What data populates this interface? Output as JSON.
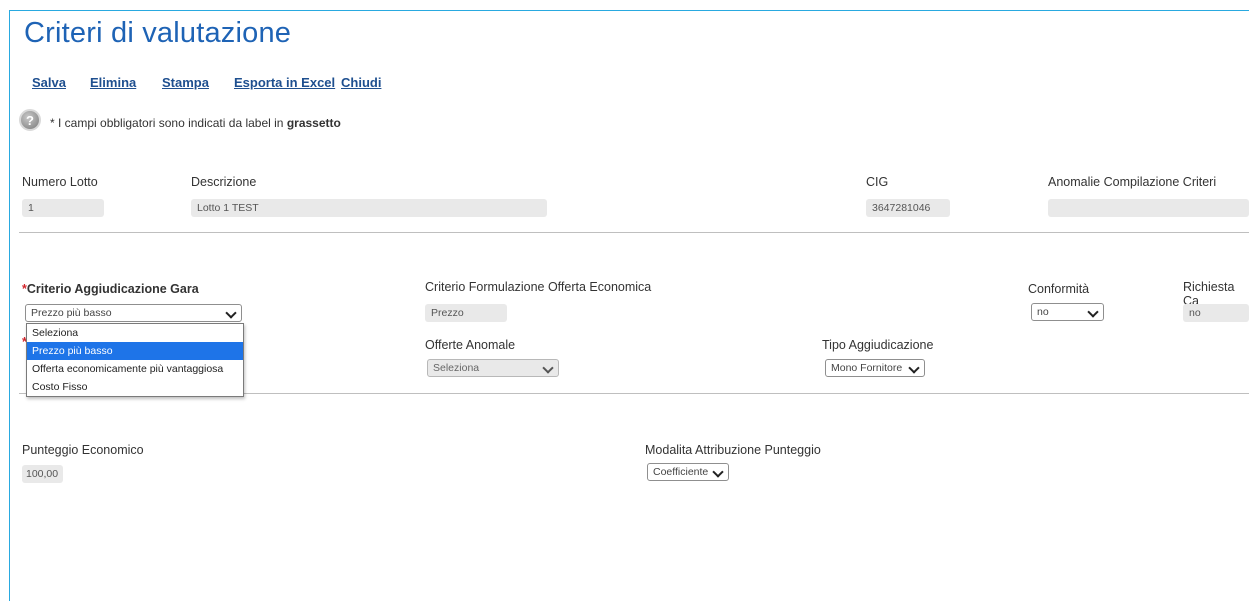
{
  "page": {
    "title": "Criteri di valutazione"
  },
  "toolbar": {
    "salva": "Salva",
    "elimina": "Elimina",
    "stampa": "Stampa",
    "esporta": "Esporta in Excel",
    "chiudi": "Chiudi"
  },
  "note": {
    "icon": "help-icon",
    "prefix": "* I campi obbligatori sono indicati da label in ",
    "bold": "grassetto"
  },
  "lotto": {
    "numero_label": "Numero Lotto",
    "numero_value": "1",
    "descrizione_label": "Descrizione",
    "descrizione_value": "Lotto 1 TEST",
    "cig_label": "CIG",
    "cig_value": "3647281046",
    "anomalie_label": "Anomalie Compilazione Criteri",
    "anomalie_value": ""
  },
  "criteri": {
    "required_mark": "*",
    "aggiudicazione_label": "Criterio Aggiudicazione Gara",
    "aggiudicazione_value": "Prezzo più basso",
    "aggiudicazione_options": [
      "Seleziona",
      "Prezzo più basso",
      "Offerta economicamente più vantaggiosa",
      "Costo Fisso"
    ],
    "aggiudicazione_selected_index": 1,
    "formulazione_label": "Criterio Formulazione Offerta Economica",
    "formulazione_value": "Prezzo",
    "conformita_label": "Conformità",
    "conformita_value": "no",
    "richiesta_label": "Richiesta Ca",
    "richiesta_value": "no",
    "offerte_anomale_label": "Offerte Anomale",
    "offerte_anomale_value": "Seleziona",
    "tipo_aggiudicazione_label": "Tipo Aggiudicazione",
    "tipo_aggiudicazione_value": "Mono Fornitore"
  },
  "punteggio": {
    "economico_label": "Punteggio Economico",
    "economico_value": "100,00",
    "modalita_label": "Modalita Attribuzione Punteggio",
    "modalita_value": "Coefficiente"
  },
  "colors": {
    "title": "#1e63b5",
    "link": "#1e4f8f",
    "required": "#d3262c",
    "selected": "#1e74e8",
    "frame": "#29a9e0"
  }
}
